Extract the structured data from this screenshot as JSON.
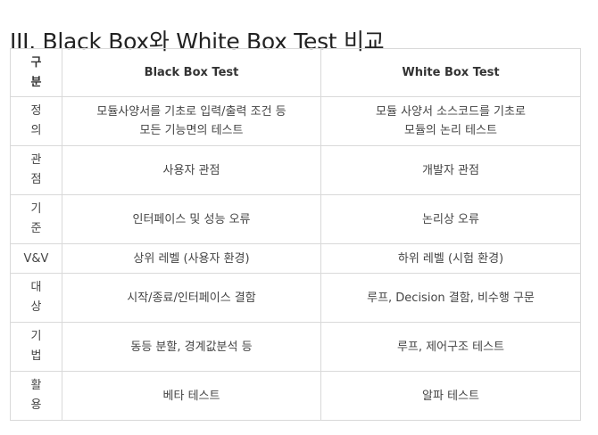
{
  "heading": "III. Black Box와 White Box Test 비교",
  "table": {
    "header": {
      "label_lines": [
        "구",
        "분"
      ],
      "col1": "Black Box Test",
      "col2": "White Box Test"
    },
    "rows": [
      {
        "label_lines": [
          "정",
          "의"
        ],
        "black": [
          "모듈사양서를 기초로 입력/출력 조건 등",
          "모든 기능면의 테스트"
        ],
        "white": [
          "모듈 사양서 소스코드를 기초로",
          "모듈의 논리 테스트"
        ]
      },
      {
        "label_lines": [
          "관",
          "점"
        ],
        "black": [
          "사용자 관점"
        ],
        "white": [
          "개발자 관점"
        ]
      },
      {
        "label_lines": [
          "기",
          "준"
        ],
        "black": [
          "인터페이스 및 성능 오류"
        ],
        "white": [
          "논리상 오류"
        ]
      },
      {
        "label_lines": [
          "V&V"
        ],
        "black": [
          "상위 레벨 (사용자 환경)"
        ],
        "white": [
          "하위 레벨 (시험 환경)"
        ]
      },
      {
        "label_lines": [
          "대",
          "상"
        ],
        "black": [
          "시작/종료/인터페이스 결함"
        ],
        "white": [
          "루프, Decision 결함, 비수행 구문"
        ]
      },
      {
        "label_lines": [
          "기",
          "법"
        ],
        "black": [
          "동등 분할, 경계값분석 등"
        ],
        "white": [
          "루프, 제어구조 테스트"
        ]
      },
      {
        "label_lines": [
          "활",
          "용"
        ],
        "black": [
          "베타 테스트"
        ],
        "white": [
          "알파 테스트"
        ]
      }
    ]
  }
}
